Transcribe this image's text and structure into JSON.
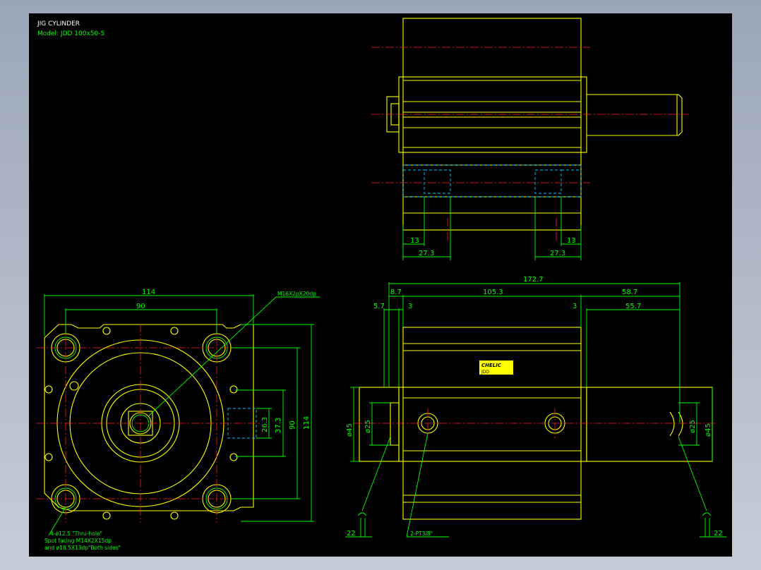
{
  "title": {
    "line1": "JIG CYLINDER",
    "line2": "Model: JDD 100x50-5"
  },
  "top_view": {
    "dim_13_left": "13",
    "dim_273_left": "27.3",
    "dim_13_right": "13",
    "dim_273_right": "27.3"
  },
  "end_view": {
    "dim_114_top": "114",
    "dim_90_top": "90",
    "dim_114_right": "114",
    "dim_90_right": "90",
    "dim_373": "37.3",
    "dim_263": "26.3",
    "thread_callout": "M16X2pX20dp",
    "hole_note_1": "4-ø12.5 \"Thru-hole\"",
    "hole_note_2": "Spot facing  M14X2X15dp",
    "hole_note_3": "and ø18.5X13dp\"Both sides\""
  },
  "side_view": {
    "dim_1727": "172.7",
    "dim_87": "8.7",
    "dim_1053": "105.3",
    "dim_587": "58.7",
    "dim_57": "5.7",
    "dim_3_left": "3",
    "dim_3_right": "3",
    "dim_557": "55.7",
    "dim_phi45_left": "ø45",
    "dim_phi25_left": "ø25",
    "dim_phi25_right": "ø25",
    "dim_phi45_right": "ø45",
    "dim_22_left": "22",
    "dim_22_right": "22",
    "port_note": "2-PT3/8\"",
    "logo_text": "CHELIC",
    "logo_sub": "JDD"
  },
  "colors": {
    "background": "#000000",
    "outline": "#ffff00",
    "dimension": "#00ff00",
    "centerline": "#ff2020",
    "hidden": "#00c8ff"
  }
}
